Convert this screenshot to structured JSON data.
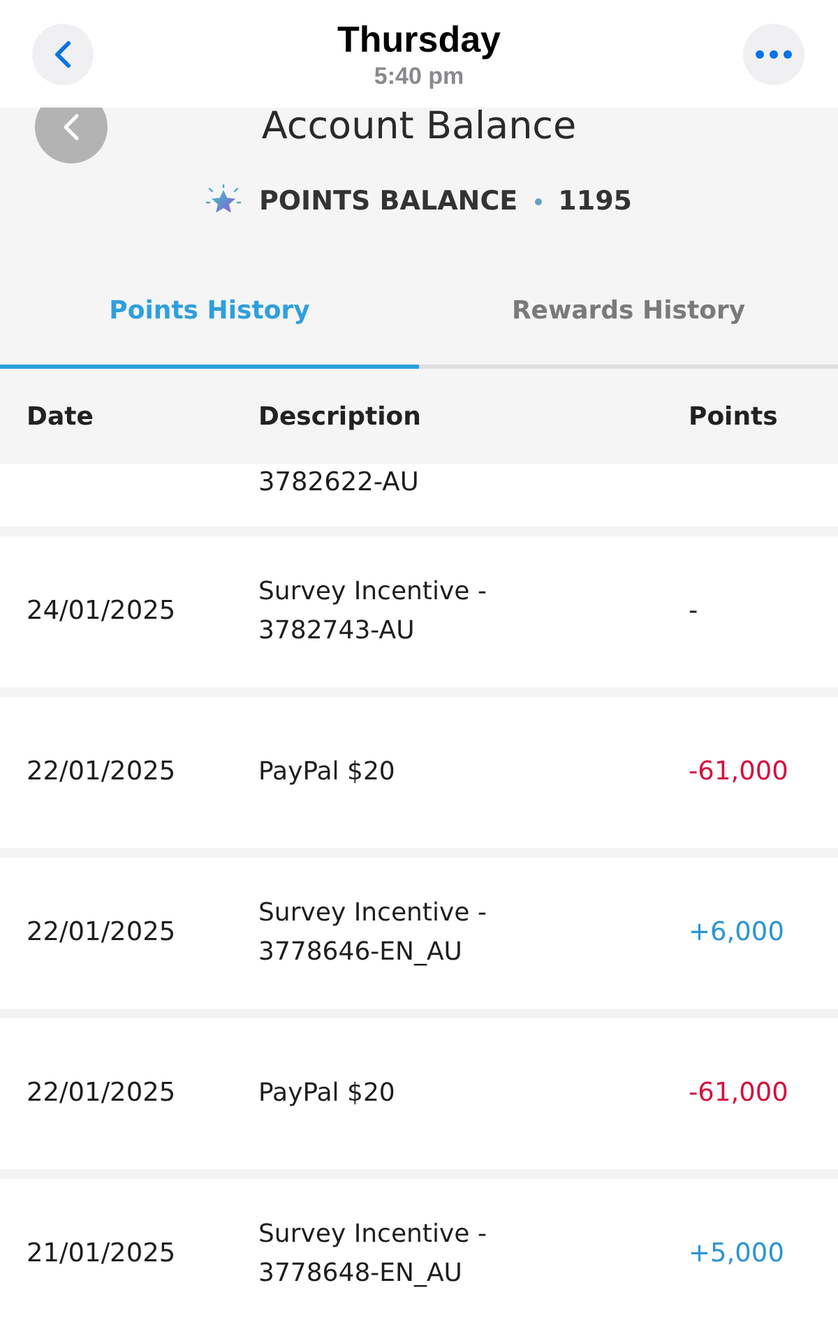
{
  "nav_bar": {
    "title": "Thursday",
    "subtitle": "5:40 pm"
  },
  "page": {
    "title": "Account Balance"
  },
  "points_balance": {
    "label": "POINTS BALANCE",
    "value": "1195"
  },
  "tabs": [
    {
      "label": "Points History",
      "selected": true
    },
    {
      "label": "Rewards History",
      "selected": false
    }
  ],
  "table": {
    "columns": [
      "Date",
      "Description",
      "Points"
    ],
    "partial_row": {
      "description": "3782622-AU"
    },
    "rows": [
      {
        "date": "24/01/2025",
        "description": [
          "Survey Incentive -",
          "3782743-AU"
        ],
        "points": "-",
        "kind": "none"
      },
      {
        "date": "22/01/2025",
        "description": [
          "PayPal $20"
        ],
        "points": "-61,000",
        "kind": "debit"
      },
      {
        "date": "22/01/2025",
        "description": [
          "Survey Incentive -",
          "3778646-EN_AU"
        ],
        "points": "+6,000",
        "kind": "credit"
      },
      {
        "date": "22/01/2025",
        "description": [
          "PayPal $20"
        ],
        "points": "-61,000",
        "kind": "debit"
      },
      {
        "date": "21/01/2025",
        "description": [
          "Survey Incentive -",
          "3778648-EN_AU"
        ],
        "points": "+5,000",
        "kind": "credit"
      }
    ]
  }
}
